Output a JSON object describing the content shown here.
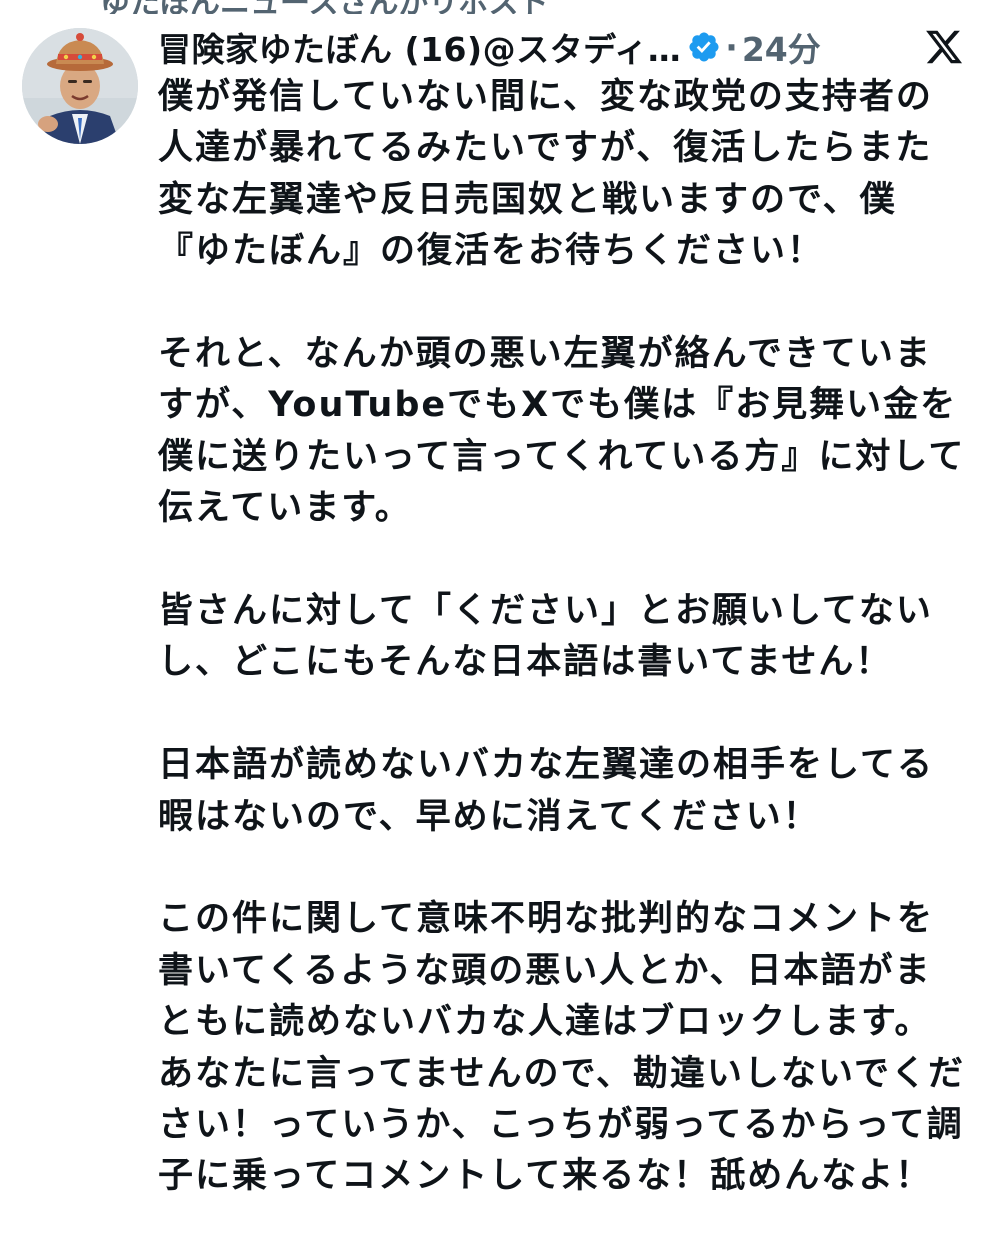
{
  "context_line": "ゆたぼんニュースさんがリポスト",
  "tweet": {
    "author": {
      "display_name": "冒険家ゆたぼん (16)@スタディ…",
      "verified": true,
      "avatar_icon": "profile-photo-avatar",
      "badge_icon": "verified-check-icon",
      "badge_color": "#1d9bf0"
    },
    "separator": "·",
    "timestamp": "24分",
    "platform_icon": "x-logo-icon",
    "paragraphs": [
      "僕が発信していない間に、変な政党の支持者の人達が暴れてるみたいですが、復活したらまた変な左翼達や反日売国奴と戦いますので、僕『ゆたぼん』の復活をお待ちください！",
      "それと、なんか頭の悪い左翼が絡んできていますが、YouTubeでもXでも僕は『お見舞い金を僕に送りたいって言ってくれている方』に対して伝えています。",
      "皆さんに対して「ください」とお願いしてないし、どこにもそんな日本語は書いてません！",
      "日本語が読めないバカな左翼達の相手をしてる暇はないので、早めに消えてください！",
      "この件に関して意味不明な批判的なコメントを書いてくるような頭の悪い人とか、日本語がまともに読めないバカな人達はブロックします。あなたに言ってませんので、勘違いしないでください！っていうか、こっちが弱ってるからって調子に乗ってコメントして来るな！舐めんなよ！"
    ]
  }
}
